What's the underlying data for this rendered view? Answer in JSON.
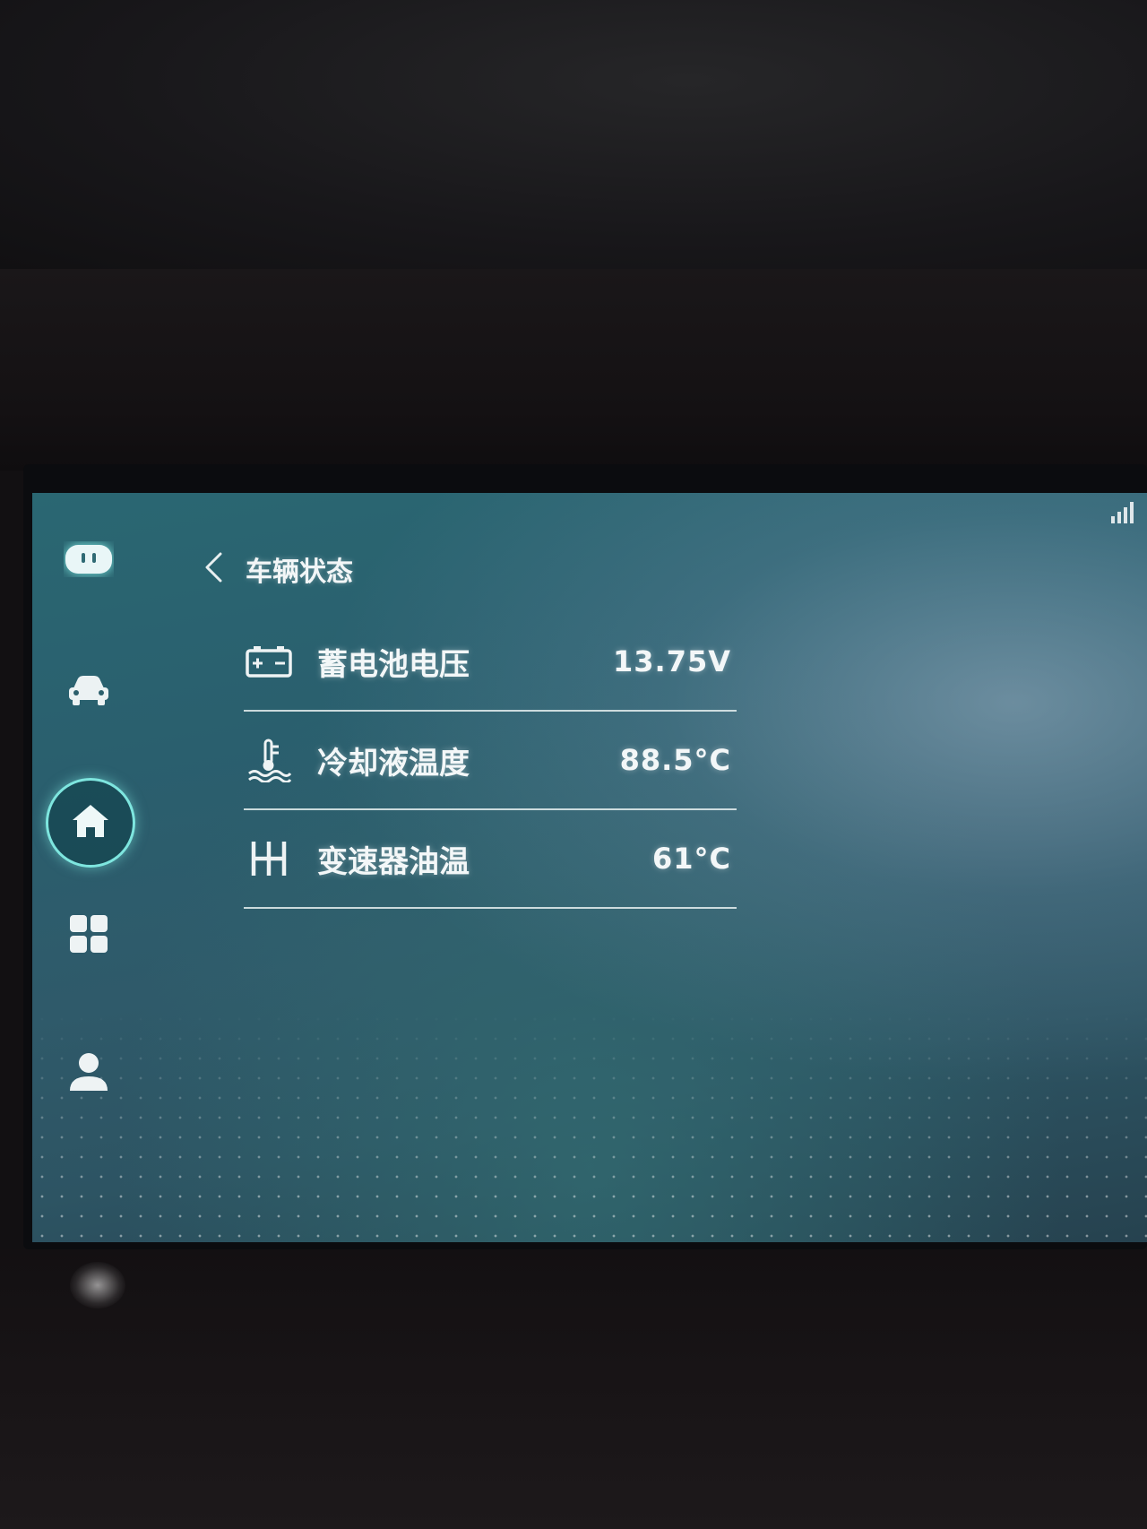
{
  "header": {
    "title": "车辆状态"
  },
  "sidebar": {
    "items": [
      {
        "icon": "assistant-icon"
      },
      {
        "icon": "car-icon"
      },
      {
        "icon": "home-icon",
        "active": true
      },
      {
        "icon": "apps-grid-icon"
      },
      {
        "icon": "user-profile-icon"
      }
    ]
  },
  "status_rows": [
    {
      "icon": "battery-icon",
      "label": "蓄电池电压",
      "value": "13.75V"
    },
    {
      "icon": "coolant-temperature-icon",
      "label": "冷却液温度",
      "value": "88.5°C"
    },
    {
      "icon": "gear-shifter-icon",
      "label": "变速器油温",
      "value": "61°C"
    }
  ],
  "colors": {
    "accent": "#7ee6df",
    "text": "#f3f7f8",
    "screen_bg": "#2d5a69"
  }
}
